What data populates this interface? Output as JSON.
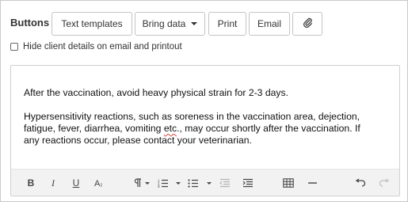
{
  "toolbar_row": {
    "label": "Buttons",
    "text_templates": "Text templates",
    "bring_data": "Bring data",
    "print": "Print",
    "email": "Email",
    "attach_icon": "paperclip-icon"
  },
  "hide_details": {
    "label": "Hide client details on email and printout",
    "checked": false
  },
  "editor": {
    "paragraph1": "After the vaccination, avoid heavy physical strain for 2-3 days.",
    "paragraph2_line1": "Hypersensitivity reactions, such as soreness in the vaccination area, dejection,",
    "paragraph2_line2a": "fatigue, fever, diarrhea, vomiting ",
    "paragraph2_etc": "etc",
    "paragraph2_line2b": "., may occur shortly after the vaccination. If",
    "paragraph2_line3": "any reactions occur, please contact your veterinarian.",
    "toolbar": {
      "bold": "B",
      "italic": "I",
      "underline": "U",
      "icons": [
        "font-size-icon",
        "paragraph-icon",
        "numbered-list-icon",
        "bulleted-list-icon",
        "outdent-icon",
        "indent-icon",
        "table-icon",
        "horizontal-line-icon",
        "undo-icon",
        "redo-icon"
      ]
    }
  }
}
